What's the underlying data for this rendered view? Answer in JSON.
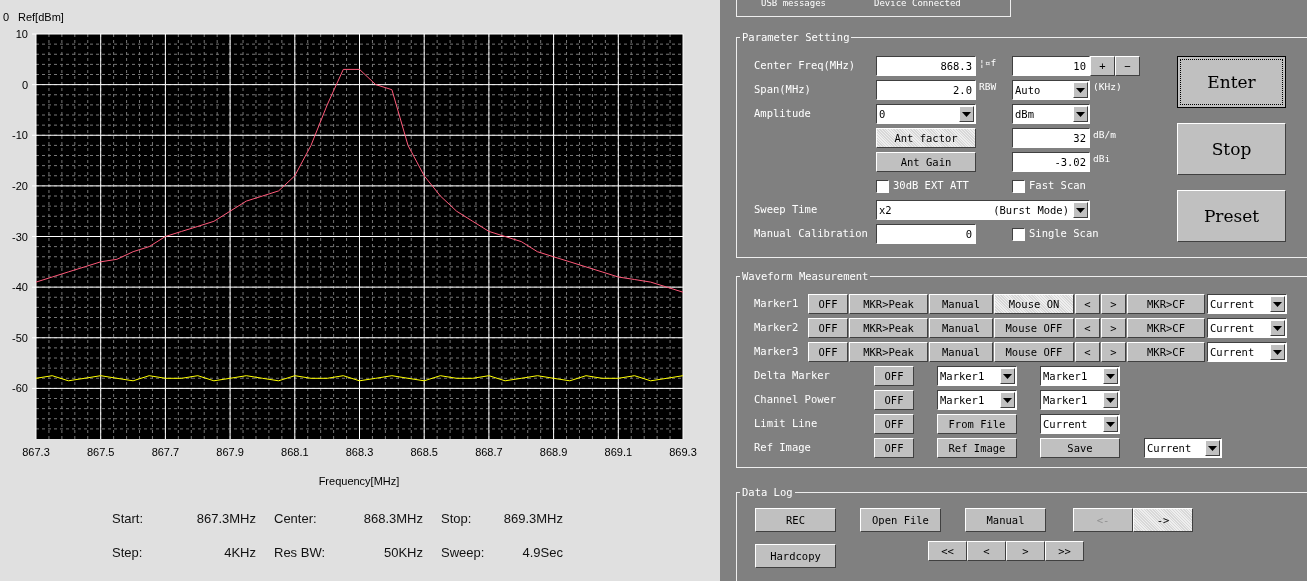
{
  "spectrum": {
    "ref_value": "0",
    "chart_data": {
      "type": "line",
      "xlabel": "Frequency[MHz]",
      "ylabel": "Ref[dBm]",
      "xlim": [
        867.3,
        869.3
      ],
      "ylim": [
        -70,
        10
      ],
      "grid": true,
      "xticks": [
        867.3,
        867.5,
        867.7,
        867.9,
        868.1,
        868.3,
        868.5,
        868.7,
        868.9,
        869.1,
        869.3
      ],
      "yticks": [
        10,
        0,
        -10,
        -20,
        -30,
        -40,
        -50,
        -60
      ],
      "x": [
        867.3,
        867.35,
        867.4,
        867.45,
        867.5,
        867.55,
        867.6,
        867.65,
        867.7,
        867.75,
        867.8,
        867.85,
        867.9,
        867.95,
        868.0,
        868.05,
        868.1,
        868.15,
        868.2,
        868.25,
        868.3,
        868.35,
        868.4,
        868.45,
        868.5,
        868.55,
        868.6,
        868.65,
        868.7,
        868.75,
        868.8,
        868.85,
        868.9,
        868.95,
        869.0,
        869.05,
        869.1,
        869.15,
        869.2,
        869.25,
        869.3
      ],
      "series": [
        {
          "color": "#ff5a7a",
          "values": [
            -39,
            -38,
            -37,
            -36,
            -35,
            -34.5,
            -33,
            -32,
            -30,
            -29,
            -28,
            -27,
            -25,
            -23,
            -22,
            -21,
            -18,
            -12,
            -4,
            3,
            3,
            0,
            -1,
            -12,
            -18,
            -22,
            -25,
            -27,
            -29,
            -30,
            -31,
            -33,
            -34,
            -35,
            -36,
            -37,
            -38,
            -38.5,
            -39,
            -40,
            -41
          ]
        },
        {
          "color": "#ffff00",
          "values": [
            -58,
            -57.5,
            -58.5,
            -58,
            -57.5,
            -58,
            -58.5,
            -57.5,
            -58,
            -58,
            -57.5,
            -58.5,
            -58,
            -57.5,
            -58,
            -58.5,
            -57.5,
            -58,
            -58,
            -57.5,
            -58.5,
            -58,
            -57.5,
            -58,
            -58.5,
            -57.5,
            -58,
            -58,
            -57.5,
            -58.5,
            -58,
            -57.5,
            -58,
            -58.5,
            -57.5,
            -58,
            -58,
            -57.5,
            -58.5,
            -58,
            -57.5
          ]
        }
      ]
    }
  },
  "summary": [
    {
      "label": "Start:",
      "value": "867.3MHz"
    },
    {
      "label": "Center:",
      "value": "868.3MHz"
    },
    {
      "label": "Stop:",
      "value": "869.3MHz"
    },
    {
      "label": "Step:",
      "value": "4KHz"
    },
    {
      "label": "Res BW:",
      "value": "50KHz"
    },
    {
      "label": "Sweep:",
      "value": "4.9Sec"
    }
  ],
  "usb": {
    "label": "USB messages",
    "value": "Device Connected"
  },
  "parameter_setting": {
    "title": "Parameter Setting",
    "center_freq": {
      "label": "Center Freq(MHz)",
      "value": "868.3"
    },
    "step": {
      "label": "¦¤f",
      "value": "10",
      "buttons": [
        "+",
        "−"
      ]
    },
    "span": {
      "label": "Span(MHz)",
      "value": "2.0"
    },
    "rbw": {
      "label": "RBW",
      "value": "Auto",
      "unit": "(KHz)"
    },
    "amplitude": {
      "label": "Amplitude",
      "value": "0",
      "unit_value": "dBm"
    },
    "ant_factor": {
      "button": "Ant factor",
      "selected": true,
      "value": "32",
      "unit": "dB/m"
    },
    "ant_gain": {
      "button": "Ant Gain",
      "selected": false,
      "value": "-3.02",
      "unit": "dBi"
    },
    "ext_att": {
      "label": "30dB EXT ATT",
      "checked": false
    },
    "fast_scan": {
      "label": "Fast Scan",
      "checked": false
    },
    "sweep_time": {
      "label": "Sweep Time",
      "value": "x2",
      "mode": "(Burst Mode)"
    },
    "manual_calibration": {
      "label": "Manual Calibration",
      "value": "0"
    },
    "single_scan": {
      "label": "Single Scan",
      "checked": false
    },
    "actions": [
      {
        "label": "Enter",
        "selected": true
      },
      {
        "label": "Stop",
        "selected": false
      },
      {
        "label": "Preset",
        "selected": false
      }
    ]
  },
  "waveform_measurement": {
    "title": "Waveform Measurement",
    "markers": [
      {
        "label": "Marker1",
        "buttons": [
          {
            "label": "OFF",
            "selected": false
          },
          {
            "label": "MKR>Peak",
            "selected": false
          },
          {
            "label": "Manual",
            "selected": false
          },
          {
            "label": "Mouse ON",
            "selected": true
          },
          {
            "label": "<",
            "selected": false
          },
          {
            "label": ">",
            "selected": false
          },
          {
            "label": "MKR>CF",
            "selected": false
          }
        ],
        "select": "Current"
      },
      {
        "label": "Marker2",
        "buttons": [
          {
            "label": "OFF",
            "selected": false
          },
          {
            "label": "MKR>Peak",
            "selected": false
          },
          {
            "label": "Manual",
            "selected": false
          },
          {
            "label": "Mouse OFF",
            "selected": false
          },
          {
            "label": "<",
            "selected": false
          },
          {
            "label": ">",
            "selected": false
          },
          {
            "label": "MKR>CF",
            "selected": false
          }
        ],
        "select": "Current"
      },
      {
        "label": "Marker3",
        "buttons": [
          {
            "label": "OFF",
            "selected": false
          },
          {
            "label": "MKR>Peak",
            "selected": false
          },
          {
            "label": "Manual",
            "selected": false
          },
          {
            "label": "Mouse OFF",
            "selected": false
          },
          {
            "label": "<",
            "selected": false
          },
          {
            "label": ">",
            "selected": false
          },
          {
            "label": "MKR>CF",
            "selected": false
          }
        ],
        "select": "Current"
      }
    ],
    "rows": [
      {
        "label": "Delta Marker",
        "items": [
          {
            "kind": "button",
            "text": "OFF"
          },
          {
            "kind": "select",
            "text": "Marker1"
          },
          {
            "kind": "select",
            "text": "Marker1"
          }
        ]
      },
      {
        "label": "Channel Power",
        "items": [
          {
            "kind": "button",
            "text": "OFF"
          },
          {
            "kind": "select",
            "text": "Marker1"
          },
          {
            "kind": "select",
            "text": "Marker1"
          }
        ]
      },
      {
        "label": "Limit Line",
        "items": [
          {
            "kind": "button",
            "text": "OFF"
          },
          {
            "kind": "button",
            "text": "From File"
          },
          {
            "kind": "select",
            "text": "Current"
          }
        ]
      },
      {
        "label": "Ref Image",
        "items": [
          {
            "kind": "button",
            "text": "OFF"
          },
          {
            "kind": "button",
            "text": "Ref Image"
          },
          {
            "kind": "button",
            "text": "Save"
          },
          {
            "kind": "select",
            "text": "Current"
          }
        ]
      }
    ]
  },
  "data_log": {
    "title": "Data Log",
    "buttons": [
      {
        "label": "REC",
        "disabled": false,
        "selected": false
      },
      {
        "label": "Open File",
        "disabled": false,
        "selected": false
      },
      {
        "label": "Manual",
        "disabled": false,
        "selected": false
      },
      {
        "label": "<-",
        "disabled": true,
        "selected": false
      },
      {
        "label": "->",
        "disabled": false,
        "selected": true
      }
    ],
    "hardcopy": "Hardcopy",
    "navigation": [
      "<<",
      "<",
      ">",
      ">>"
    ]
  }
}
